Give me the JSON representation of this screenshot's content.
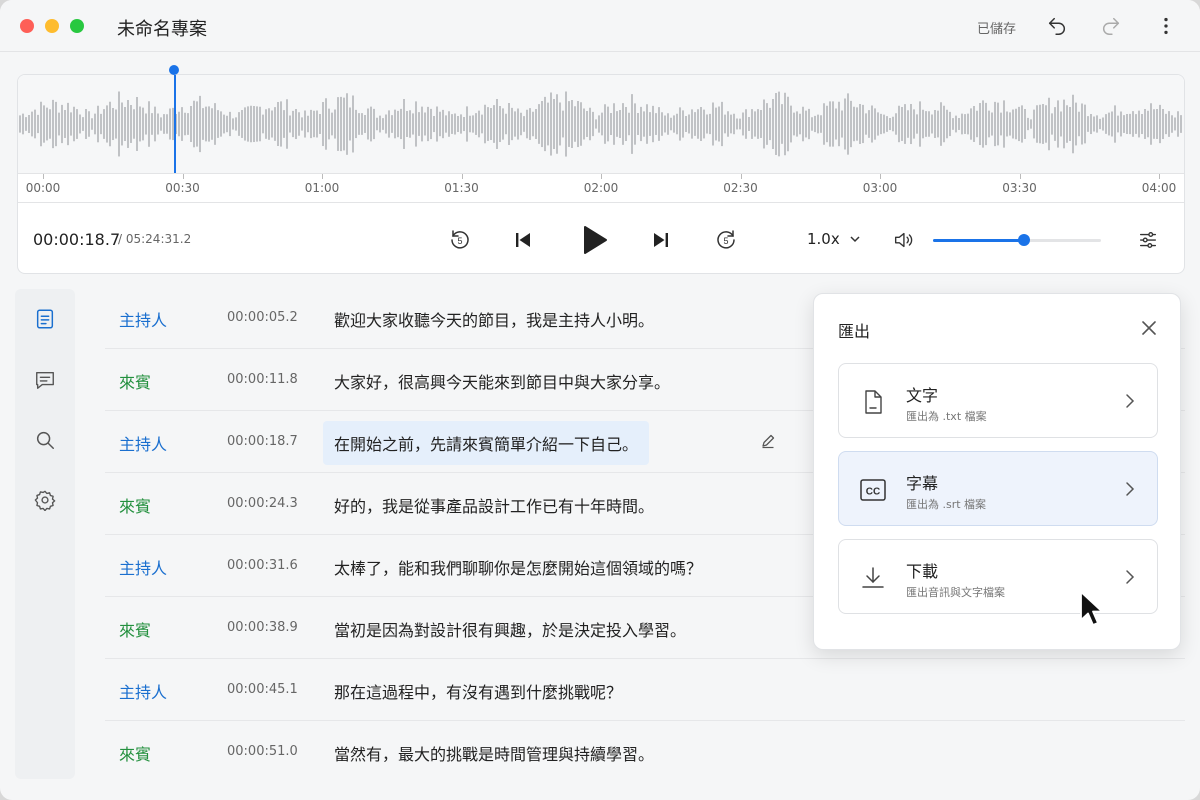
{
  "window": {
    "title": "未命名專案",
    "saved_status": "已儲存"
  },
  "timeline": {
    "ticks": [
      "00:00",
      "00:30",
      "01:00",
      "01:30",
      "02:00",
      "02:30",
      "03:00",
      "03:30",
      "04:00"
    ]
  },
  "player": {
    "current_time": "00:00:18.7",
    "total_time": "/ 05:24:31.2",
    "speed": "1.0x",
    "volume_fraction": 0.54,
    "playhead_seconds": 18.7
  },
  "transcript": [
    {
      "speaker": "主持人",
      "role": "host",
      "time": "00:00:05.2",
      "text": "歡迎大家收聽今天的節目，我是主持人小明。"
    },
    {
      "speaker": "來賓",
      "role": "guest",
      "time": "00:00:11.8",
      "text": "大家好，很高興今天能來到節目中與大家分享。"
    },
    {
      "speaker": "主持人",
      "role": "host",
      "time": "00:00:18.7",
      "text": "在開始之前，先請來賓簡單介紹一下自己。",
      "active": true
    },
    {
      "speaker": "來賓",
      "role": "guest",
      "time": "00:00:24.3",
      "text": "好的，我是從事產品設計工作已有十年時間。"
    },
    {
      "speaker": "主持人",
      "role": "host",
      "time": "00:00:31.6",
      "text": "太棒了，能和我們聊聊你是怎麼開始這個領域的嗎？"
    },
    {
      "speaker": "來賓",
      "role": "guest",
      "time": "00:00:38.9",
      "text": "當初是因為對設計很有興趣，於是決定投入學習。"
    },
    {
      "speaker": "主持人",
      "role": "host",
      "time": "00:00:45.1",
      "text": "那在這過程中，有沒有遇到什麼挑戰呢？"
    },
    {
      "speaker": "來賓",
      "role": "guest",
      "time": "00:00:51.0",
      "text": "當然有，最大的挑戰是時間管理與持續學習。"
    }
  ],
  "export_panel": {
    "title": "匯出",
    "options": [
      {
        "title": "文字",
        "subtitle": "匯出為 .txt 檔案",
        "icon": "document-icon"
      },
      {
        "title": "字幕",
        "subtitle": "匯出為 .srt 檔案",
        "icon": "cc-icon",
        "selected": true
      },
      {
        "title": "下載",
        "subtitle": "匯出音訊與文字檔案",
        "icon": "download-icon"
      }
    ]
  },
  "colors": {
    "accent": "#1a73e8",
    "host": "#1a6fcf",
    "guest": "#23903e",
    "selected_bg": "#eef3fc"
  }
}
